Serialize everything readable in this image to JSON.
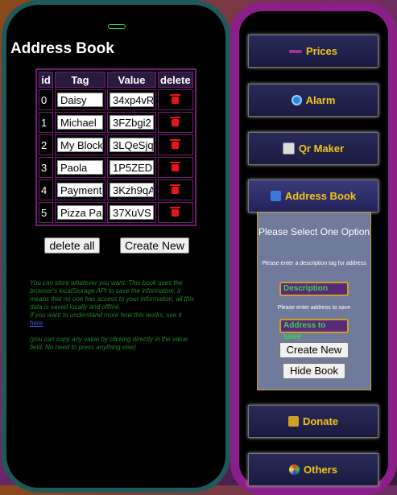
{
  "address_book": {
    "title": "Address Book",
    "columns": [
      "id",
      "Tag",
      "Value",
      "delete"
    ],
    "rows": [
      {
        "id": "0",
        "tag": "Daisy",
        "value": "34xp4vR"
      },
      {
        "id": "1",
        "tag": "Michael",
        "value": "3FZbgi2"
      },
      {
        "id": "2",
        "tag": "My Block",
        "value": "3LQeSjq"
      },
      {
        "id": "3",
        "tag": "Paola",
        "value": "1P5ZED"
      },
      {
        "id": "4",
        "tag": "Payment",
        "value": "3Kzh9qA"
      },
      {
        "id": "5",
        "tag": "Pizza Pa",
        "value": "37XuVS"
      }
    ],
    "delete_all_label": "delete all",
    "create_new_label": "Create New",
    "info_text": "You can store whatever you want. This book uses the browser's localStorage API to save the information, it means that no one has access to your information, all this data is saved locally and offline.",
    "info_link_prefix": "If you want to understand more how this works, see it",
    "info_link": "here",
    "info_copy_text": "(you can copy any value by clicking directly in the value field. No need to press anything else)"
  },
  "menu": {
    "prices_label": "Prices",
    "alarm_label": "Alarm",
    "qr_label": "Qr Maker",
    "address_label": "Address Book",
    "donate_label": "Donate",
    "others_label": "Others"
  },
  "panel": {
    "heading": "Please Select One Option",
    "desc_prompt": "Please enter a description tag for address",
    "desc_placeholder": "Description",
    "addr_prompt": "Please enter address to save",
    "addr_placeholder": "Address to save",
    "create_label": "Create New",
    "hide_label": "Hide Book"
  },
  "colors": {
    "accent_gold": "#f5c518",
    "frame_teal": "#1e5a5c",
    "frame_purple": "#8a1f8a",
    "info_green": "#1f8a1f",
    "trash_red": "#e8141a"
  }
}
